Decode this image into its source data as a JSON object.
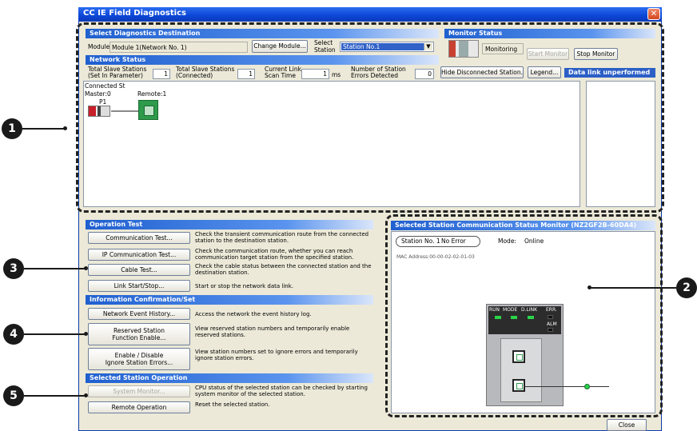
{
  "window": {
    "title": "CC IE Field Diagnostics",
    "close_glyph": "✕"
  },
  "select_dest": {
    "header": "Select Diagnostics Destination",
    "module_label": "Module",
    "module_value": "Module 1(Network No. 1)",
    "change_module": "Change Module...",
    "select_station_label_1": "Select",
    "select_station_label_2": "Station",
    "station_value": "Station No.1"
  },
  "monitor": {
    "header": "Monitor Status",
    "status": "Monitoring",
    "start_btn": "Start Monitor",
    "stop_btn": "Stop Monitor"
  },
  "network_status": {
    "header": "Network Status",
    "total_param_label_1": "Total Slave Stations",
    "total_param_label_2": "(Set In Parameter)",
    "total_param_value": "1",
    "total_conn_label_1": "Total Slave Stations",
    "total_conn_label_2": "(Connected)",
    "total_conn_value": "1",
    "scan_label_1": "Current Link",
    "scan_label_2": "Scan Time",
    "scan_value": "1",
    "scan_unit": "ms",
    "errors_label_1": "Number of Station",
    "errors_label_2": "Errors Detected",
    "errors_value": "0",
    "hide_btn": "Hide Disconnected Station...",
    "legend_btn": "Legend...",
    "datalink": "Data link unperformed"
  },
  "topology": {
    "connected_label": "Connected St",
    "master_label": "Master:0",
    "port_label": "P1",
    "remote_label": "Remote:1"
  },
  "operation_test": {
    "header": "Operation Test",
    "items": [
      {
        "label": "Communication Test...",
        "desc": "Check the transient communication route from the connected station to the destination station."
      },
      {
        "label": "IP Communication Test...",
        "desc": "Check the communication route, whether you can reach communication target station from the specified station."
      },
      {
        "label": "Cable Test...",
        "desc": "Check the cable status between the connected station and the destination station."
      },
      {
        "label": "Link Start/Stop...",
        "desc": "Start or stop the network data link."
      }
    ]
  },
  "info": {
    "header": "Information Confirmation/Set",
    "items": [
      {
        "label": "Network Event History...",
        "desc": "Access the network the event history log."
      },
      {
        "label_1": "Reserved Station",
        "label_2": "Function Enable...",
        "desc": "View reserved station numbers and temporarily enable reserved stations."
      },
      {
        "label_1": "Enable / Disable",
        "label_2": "Ignore Station Errors...",
        "desc": "View station numbers set to ignore errors and temporarily ignore station errors."
      }
    ]
  },
  "selected_op": {
    "header": "Selected Station Operation",
    "items": [
      {
        "label": "System Monitor...",
        "desc": "CPU status of the selected station can be checked by starting system monitor of the selected station."
      },
      {
        "label": "Remote Operation",
        "desc": "Reset the selected station."
      }
    ]
  },
  "status_monitor": {
    "header": "Selected Station Communication Status Monitor (NZ2GF2B-60DA4)",
    "station": "Station No. 1",
    "error": "No Error",
    "mode_label": "Mode:",
    "mode_value": "Online",
    "mac": "MAC Address:00-00-02-02-01-03",
    "leds": [
      "RUN",
      "MODE",
      "D.LINK",
      "ERR.",
      "ALM"
    ]
  },
  "footer": {
    "close": "Close"
  },
  "callouts": [
    "1",
    "2",
    "3",
    "4",
    "5"
  ]
}
